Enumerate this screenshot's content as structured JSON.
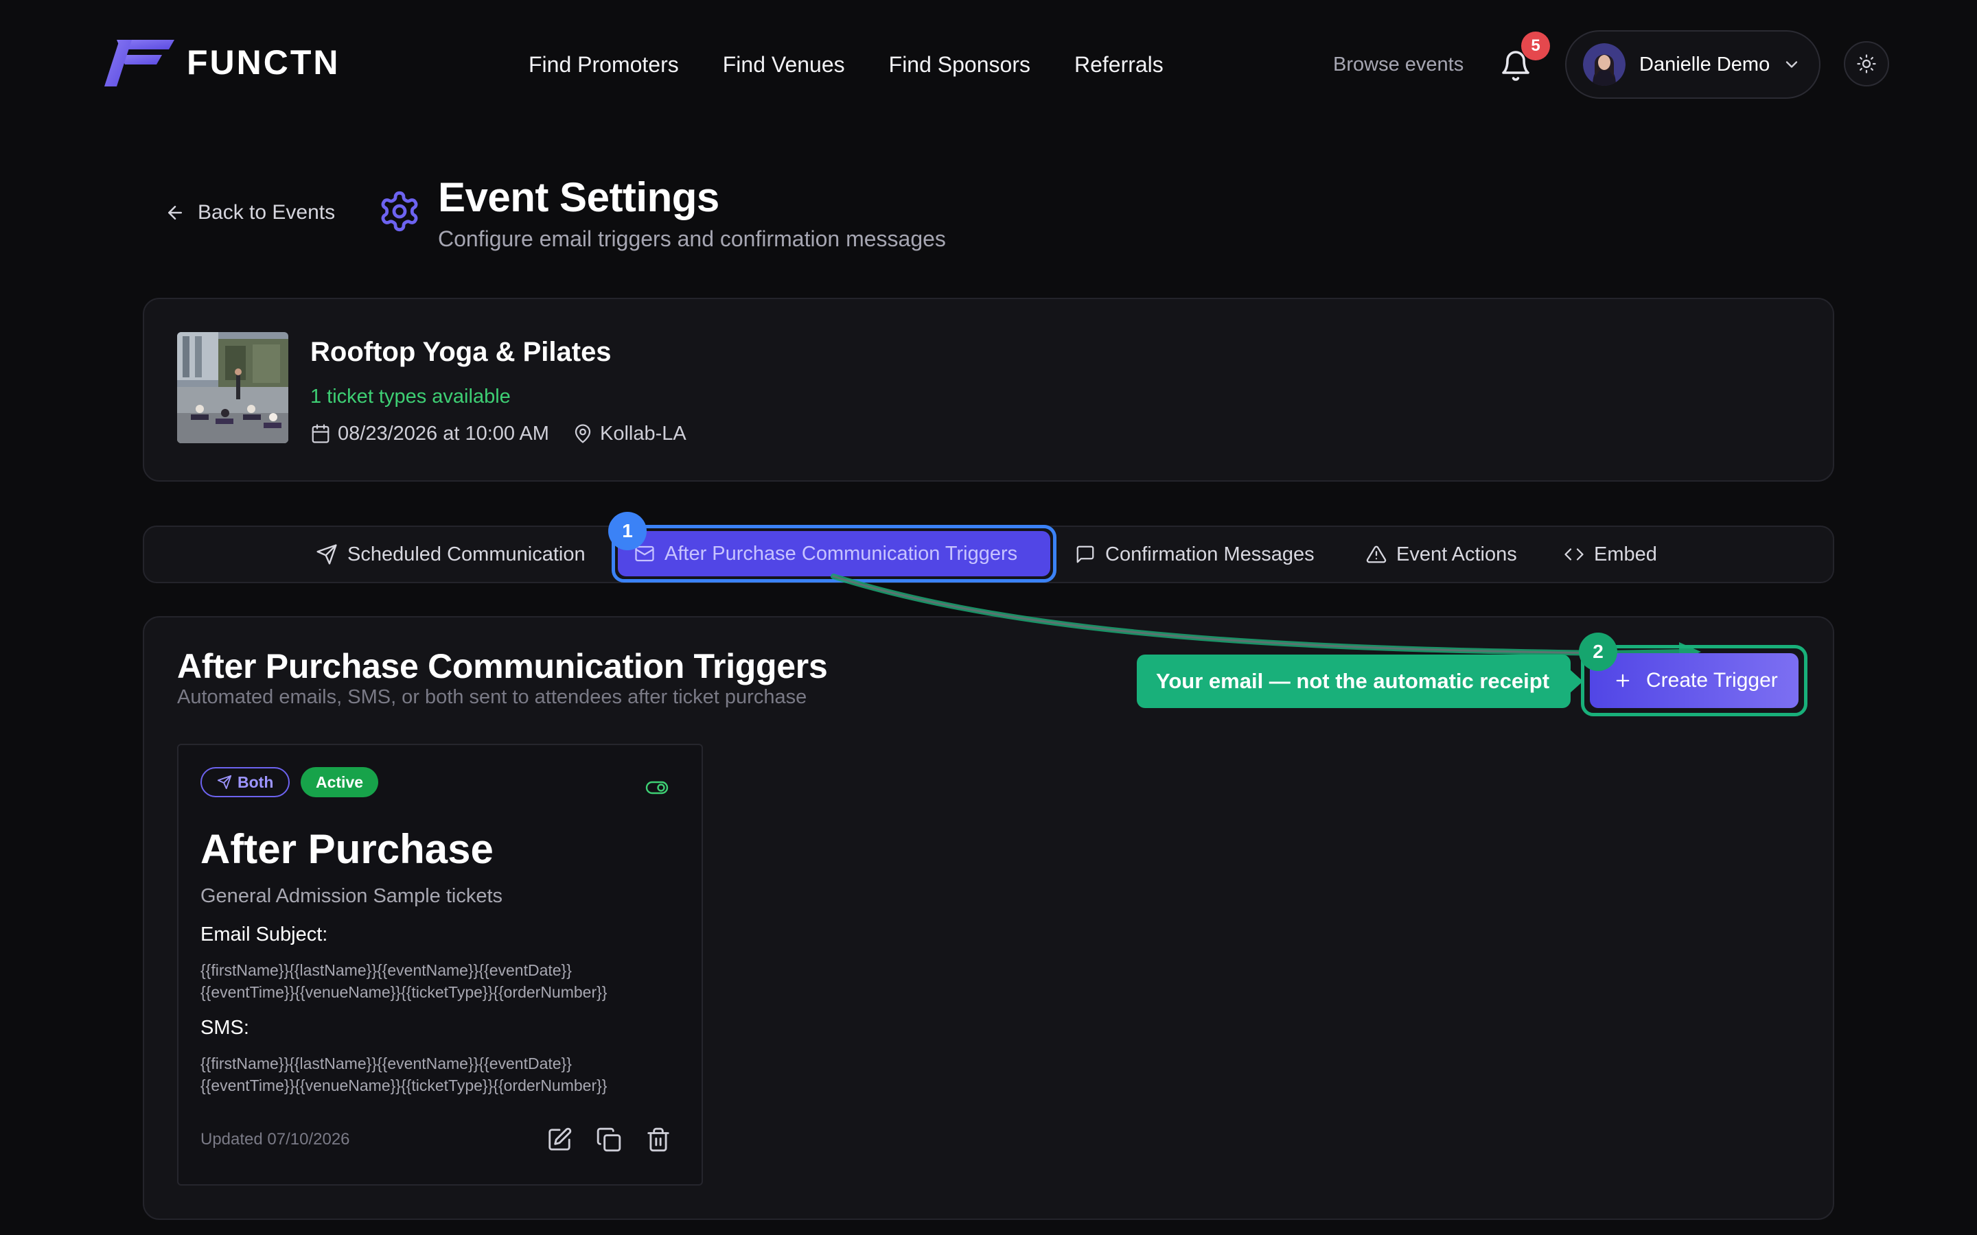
{
  "header": {
    "brand": "FUNCTN",
    "nav": [
      "Find Promoters",
      "Find Venues",
      "Find Sponsors",
      "Referrals"
    ],
    "browse_label": "Browse events",
    "notification_count": "5",
    "user_name": "Danielle Demo",
    "icons": {
      "bell": "bell-icon",
      "chevron": "chevron-down-icon",
      "theme": "sun-icon"
    }
  },
  "page": {
    "back_label": "Back to Events",
    "title": "Event Settings",
    "subtitle": "Configure email triggers and confirmation messages"
  },
  "event": {
    "name": "Rooftop Yoga & Pilates",
    "tickets_available": "1 ticket types available",
    "date_time": "08/23/2026 at 10:00 AM",
    "venue": "Kollab-LA"
  },
  "tabs": [
    {
      "label": "Scheduled Communication",
      "icon": "send-icon"
    },
    {
      "label": "After Purchase Communication Triggers",
      "icon": "mail-icon",
      "active": true
    },
    {
      "label": "Confirmation Messages",
      "icon": "message-square-icon"
    },
    {
      "label": "Event Actions",
      "icon": "alert-triangle-icon"
    },
    {
      "label": "Embed",
      "icon": "code-icon"
    }
  ],
  "section": {
    "title": "After Purchase Communication Triggers",
    "subtitle": "Automated emails, SMS, or both sent to attendees after ticket purchase",
    "create_label": "Create Trigger"
  },
  "annotations": {
    "step1": "1",
    "step2": "2",
    "callout": "Your email — not the automatic receipt",
    "colors": {
      "step1": "#3b82f6",
      "step2": "#16a56e",
      "callout": "#19b07a"
    }
  },
  "trigger": {
    "channel_badge": "Both",
    "status_badge": "Active",
    "name": "After Purchase",
    "tickets": "General Admission Sample tickets",
    "email_subject_label": "Email Subject:",
    "email_subject_line1": "{{firstName}}{{lastName}}{{eventName}}{{eventDate}}",
    "email_subject_line2": "{{eventTime}}{{venueName}}{{ticketType}}{{orderNumber}}",
    "sms_label": "SMS:",
    "sms_line1": "{{firstName}}{{lastName}}{{eventName}}{{eventDate}}",
    "sms_line2": "{{eventTime}}{{venueName}}{{ticketType}}{{orderNumber}}",
    "updated": "Updated 07/10/2026"
  },
  "theme": {
    "accent": "#5146e6",
    "success": "#17a34a",
    "background": "#0c0c0e",
    "card": "#141418"
  }
}
